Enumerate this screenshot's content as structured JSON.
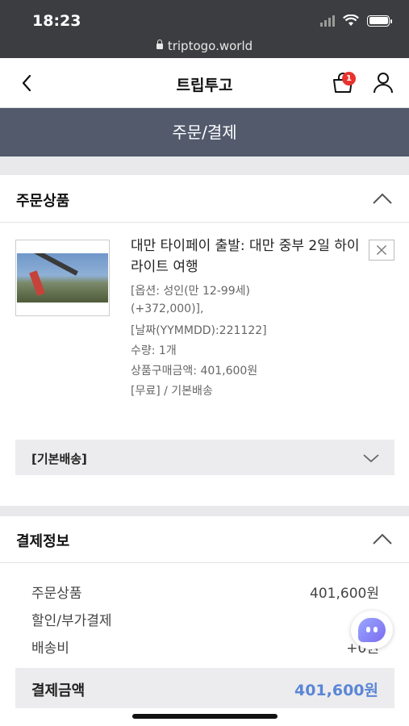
{
  "status_bar": {
    "time": "18:23",
    "url": "triptogo.world"
  },
  "header": {
    "title": "트립투고",
    "cart_badge": "1"
  },
  "banner": {
    "title": "주문/결제"
  },
  "order_section": {
    "title": "주문상품",
    "product": {
      "name": "대만 타이페이 출발: 대만 중부 2일 하이라이트 여행",
      "option_line1": "[옵션: 성인(만 12-99세)",
      "option_line2": "(+372,000)],",
      "date_line": "[날짜(YYMMDD):221122]",
      "quantity": "수량: 1개",
      "price": "상품구매금액: 401,600원",
      "shipping": "[무료] / 기본배송"
    },
    "shipping_group": "[기본배송]"
  },
  "payment_section": {
    "title": "결제정보",
    "rows": [
      {
        "label": "주문상품",
        "value": "401,600원"
      },
      {
        "label": "할인/부가결제",
        "value": "-0원"
      },
      {
        "label": "배송비",
        "value": "+0원"
      }
    ],
    "total_label": "결제금액",
    "total_value": "401,600원"
  },
  "colors": {
    "banner": "#525a6c",
    "badge": "#e8322d",
    "total_accent": "#5b86d6"
  },
  "icons": [
    "back-arrow-icon",
    "cart-icon",
    "user-icon",
    "chevron-up-icon",
    "close-icon",
    "chevron-down-icon",
    "chatbot-icon"
  ]
}
